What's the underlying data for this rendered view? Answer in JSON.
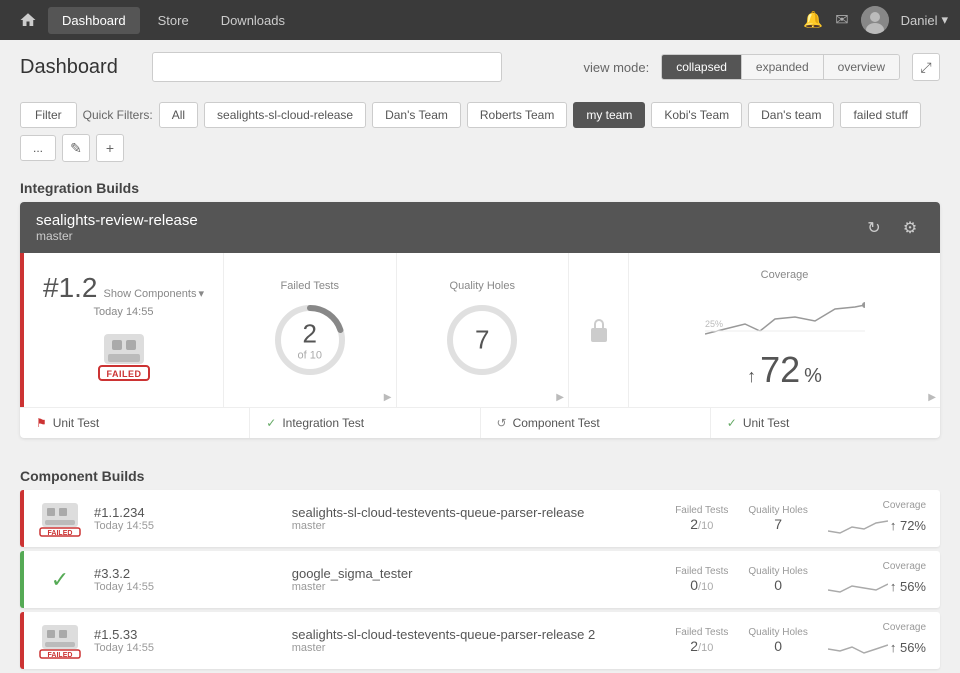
{
  "nav": {
    "tabs": [
      "Dashboard",
      "Store",
      "Downloads"
    ],
    "active_tab": "Dashboard",
    "user": "Daniel",
    "home_icon": "⌂"
  },
  "header": {
    "title": "Dashboard",
    "search_placeholder": "",
    "view_mode_label": "view mode:",
    "view_modes": [
      "collapsed",
      "expanded",
      "overview"
    ],
    "active_view": "collapsed",
    "expand_icon": "⤢"
  },
  "filters": {
    "filter_btn": "Filter",
    "quick_filters_label": "Quick Filters:",
    "pills": [
      "All",
      "sealights-sl-cloud-release",
      "Dan's Team",
      "Roberts Team",
      "my team",
      "Kobi's Team",
      "Dan's team",
      "failed stuff",
      "..."
    ],
    "active_pill": "my team",
    "edit_icon": "✎",
    "add_icon": "+"
  },
  "integration_builds": {
    "section_title": "Integration Builds",
    "card": {
      "title": "sealights-review-release",
      "subtitle": "master",
      "build_num": "#1.2",
      "show_components": "Show Components",
      "build_time": "Today 14:55",
      "status": "FAILED",
      "failed_tests": {
        "label": "Failed Tests",
        "value": "2",
        "denom": "of 10"
      },
      "quality_holes": {
        "label": "Quality Holes",
        "value": "7"
      },
      "coverage": {
        "label": "Coverage",
        "value": "72",
        "arrow": "↑",
        "percent": "%"
      },
      "footer": [
        {
          "icon": "flag",
          "label": "Unit Test"
        },
        {
          "icon": "check",
          "label": "Integration Test"
        },
        {
          "icon": "spinner",
          "label": "Component Test"
        },
        {
          "icon": "check",
          "label": "Unit Test"
        }
      ]
    }
  },
  "component_builds": {
    "section_title": "Component Builds",
    "rows": [
      {
        "build_num": "#1.1.234",
        "build_time": "Today 14:55",
        "name": "sealights-sl-cloud-testevents-queue-parser-release",
        "branch": "master",
        "status": "failed",
        "failed_tests_label": "Failed Tests",
        "failed_tests": "2",
        "failed_denom": "/10",
        "quality_holes_label": "Quality Holes",
        "quality_holes": "7",
        "coverage_label": "Coverage",
        "coverage_arrow": "↑",
        "coverage": "72%"
      },
      {
        "build_num": "#3.3.2",
        "build_time": "Today 14:55",
        "name": "google_sigma_tester",
        "branch": "master",
        "status": "success",
        "failed_tests_label": "Failed Tests",
        "failed_tests": "0",
        "failed_denom": "/10",
        "quality_holes_label": "Quality Holes",
        "quality_holes": "0",
        "coverage_label": "Coverage",
        "coverage_arrow": "↑",
        "coverage": "56%"
      },
      {
        "build_num": "#1.5.33",
        "build_time": "Today 14:55",
        "name": "sealights-sl-cloud-testevents-queue-parser-release 2",
        "branch": "master",
        "status": "failed",
        "failed_tests_label": "Failed Tests",
        "failed_tests": "2",
        "failed_denom": "/10",
        "quality_holes_label": "Quality Holes",
        "quality_holes": "0",
        "coverage_label": "Coverage",
        "coverage_arrow": "↑",
        "coverage": "56%"
      }
    ]
  }
}
